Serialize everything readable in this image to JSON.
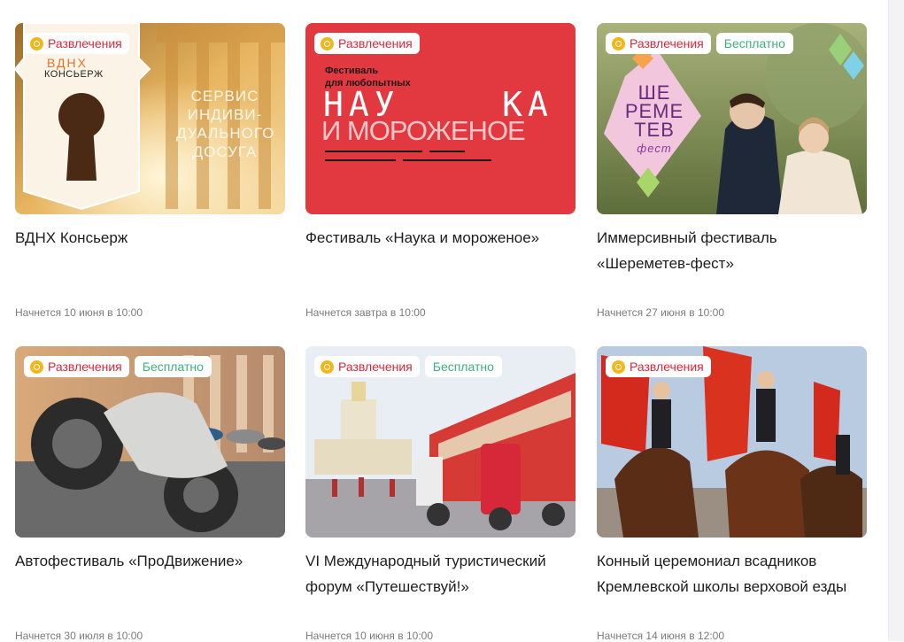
{
  "tags": {
    "entertainment": "Развлечения",
    "free": "Бесплатно"
  },
  "colors": {
    "entertainment_tag": "#d8283c",
    "free_tag": "#3fae7e",
    "tag_icon": "#f2b51a",
    "date_text": "#7a7a80"
  },
  "cards": [
    {
      "title": "ВДНХ Консьерж",
      "date": "Начнется 10 июня в 10:00",
      "is_free": false,
      "image": {
        "logo_line1": "ВДНХ",
        "logo_line2": "КОНСЬЕРЖ",
        "text": [
          "СЕРВИС",
          "ИНДИВИ-",
          "ДУАЛЬНОГО",
          "ДОСУГА"
        ]
      }
    },
    {
      "title": "Фестиваль «Наука и мороженое»",
      "date": "Начнется завтра в 10:00",
      "is_free": false,
      "image": {
        "line1": "Фестиваль",
        "line2": "для любопытных",
        "big1": "НАУ    КА",
        "big2": "И МОРОЖЕНОЕ"
      }
    },
    {
      "title": "Иммерсивный фестиваль «Шереметев-фест»",
      "date": "Начнется 27 июня в 10:00",
      "is_free": true,
      "image": {
        "logo": [
          "ШЕ",
          "РЕМЕ",
          "ТЕВ"
        ],
        "sub": "фест"
      }
    },
    {
      "title": "Автофестиваль «ПроДвижение»",
      "date": "Начнется 30 июля в 10:00",
      "is_free": true,
      "image": {}
    },
    {
      "title": "VI Международный туристический форум «Путешествуй!»",
      "date": "Начнется 10 июня в 10:00",
      "is_free": true,
      "image": {}
    },
    {
      "title": "Конный церемониал всадников Кремлевской школы верховой езды",
      "date": "Начнется 14 июня в 12:00",
      "is_free": false,
      "image": {}
    }
  ]
}
